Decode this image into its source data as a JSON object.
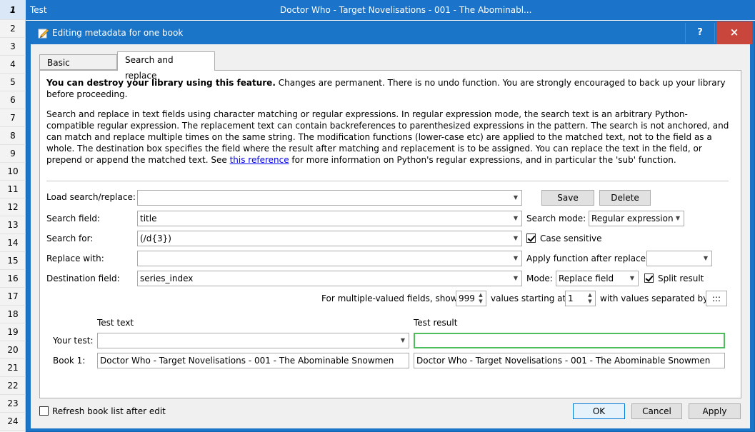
{
  "background": {
    "row_numbers": [
      "1",
      "2",
      "3",
      "4",
      "5",
      "6",
      "7",
      "8",
      "9",
      "10",
      "11",
      "12",
      "13",
      "14",
      "15",
      "16",
      "17",
      "18",
      "19",
      "20",
      "21",
      "22",
      "23",
      "24"
    ],
    "first_row_col1": "Test",
    "first_row_col2": "Doctor Who - Target Novelisations - 001 - The Abominabl..."
  },
  "dialog": {
    "title": "Editing metadata for one book",
    "help_label": "?",
    "close_label": "×"
  },
  "tabs": [
    {
      "label": "Basic metadata"
    },
    {
      "label": "Search and replace"
    }
  ],
  "warning": {
    "bold": "You can destroy your library using this feature.",
    "rest": " Changes are permanent. There is no undo function. You are strongly encouraged to back up your library before proceeding."
  },
  "description": {
    "text": "Search and replace in text fields using character matching or regular expressions. In regular expression mode, the search text is an arbitrary Python-compatible regular expression. The replacement text can contain backreferences to parenthesized expressions in the pattern. The search is not anchored, and can match and replace multiple times on the same string. The modification functions (lower-case etc) are applied to the matched text, not to the field as a whole. The destination box specifies the field where the result after matching and replacement is to be assigned. You can replace the text in the field, or prepend or append the matched text. See ",
    "link": "this reference",
    "after": " for more information on Python's regular expressions, and in particular the 'sub' function."
  },
  "form": {
    "load_label": "Load search/replace:",
    "load_value": "",
    "save_label": "Save",
    "delete_label": "Delete",
    "search_field_label": "Search field:",
    "search_field_value": "title",
    "search_mode_label": "Search mode:",
    "search_mode_value": "Regular expression",
    "search_for_label": "Search for:",
    "search_for_value": "(/d{3})",
    "case_sensitive_label": "Case sensitive",
    "case_sensitive_checked": true,
    "replace_with_label": "Replace with:",
    "replace_with_value": "",
    "apply_function_label": "Apply function after replace:",
    "apply_function_value": "",
    "destination_label": "Destination field:",
    "destination_value": "series_index",
    "mode_label": "Mode:",
    "mode_value": "Replace field",
    "split_result_label": "Split result",
    "split_result_checked": true,
    "multi_label_pre": "For multiple-valued fields, show",
    "multi_count": "999",
    "multi_label_mid": "values starting at",
    "multi_start": "1",
    "multi_label_post": "with values separated by",
    "multi_separator": ":::"
  },
  "test": {
    "test_text_header": "Test text",
    "test_result_header": "Test result",
    "your_test_label": "Your test:",
    "your_test_value": "",
    "your_test_result": "",
    "book1_label": "Book 1:",
    "book1_text": "Doctor Who - Target Novelisations - 001 - The Abominable Snowmen",
    "book1_result": "Doctor Who - Target Novelisations - 001 - The Abominable Snowmen"
  },
  "footer": {
    "refresh_label": "Refresh book list after edit",
    "refresh_checked": false,
    "ok_label": "OK",
    "cancel_label": "Cancel",
    "apply_label": "Apply"
  }
}
